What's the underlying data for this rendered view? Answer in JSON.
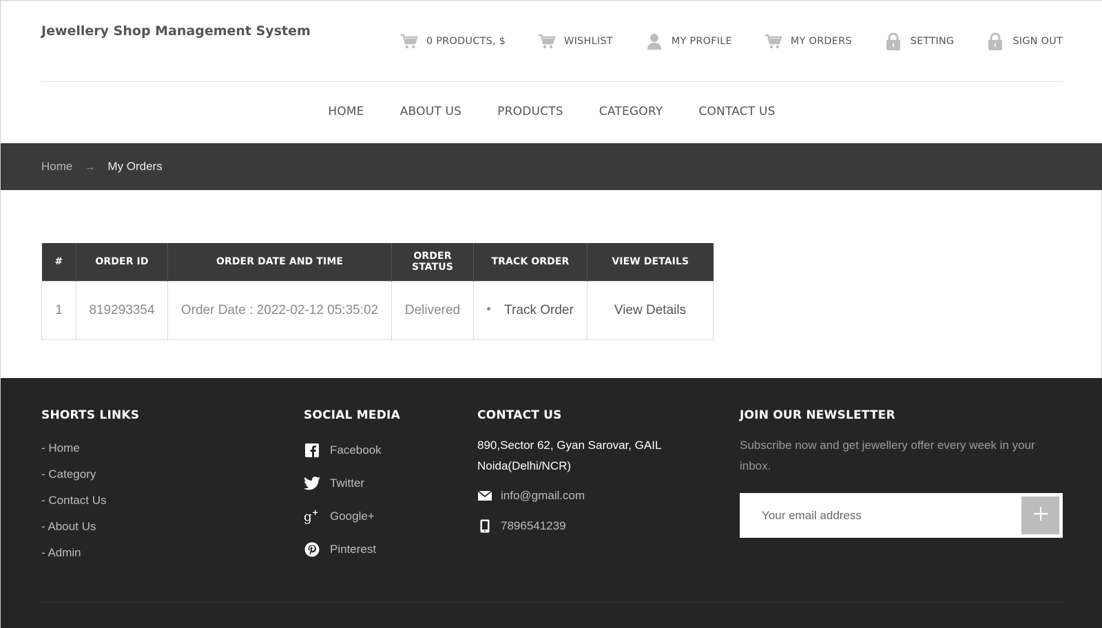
{
  "brand": "Jewellery Shop Management System",
  "topnav": [
    {
      "label": "0 PRODUCTS, $",
      "icon": "cart-icon"
    },
    {
      "label": "WISHLIST",
      "icon": "cart-icon"
    },
    {
      "label": "MY PROFILE",
      "icon": "user-icon"
    },
    {
      "label": "MY ORDERS",
      "icon": "cart-icon"
    },
    {
      "label": "SETTING",
      "icon": "lock-icon"
    },
    {
      "label": "SIGN OUT",
      "icon": "lock-icon"
    }
  ],
  "mainnav": [
    "HOME",
    "ABOUT US",
    "PRODUCTS",
    "CATEGORY",
    "CONTACT US"
  ],
  "breadcrumb": {
    "home": "Home",
    "separator": "→",
    "current": "My Orders"
  },
  "orders": {
    "headers": [
      "#",
      "ORDER ID",
      "ORDER DATE AND TIME",
      "ORDER STATUS",
      "TRACK ORDER",
      "VIEW DETAILS"
    ],
    "rows": [
      {
        "num": "1",
        "order_id": "819293354",
        "date": "Order Date : 2022-02-12 05:35:02",
        "status": "Delivered",
        "track": "Track Order",
        "view": "View Details"
      }
    ]
  },
  "footer": {
    "links_heading": "SHORTS LINKS",
    "links": [
      "- Home",
      "- Category",
      "- Contact Us",
      "- About Us",
      "- Admin"
    ],
    "social_heading": "SOCIAL MEDIA",
    "social": [
      {
        "label": "Facebook",
        "icon": "facebook-icon"
      },
      {
        "label": "Twitter",
        "icon": "twitter-icon"
      },
      {
        "label": "Google+",
        "icon": "google-plus-icon"
      },
      {
        "label": "Pinterest",
        "icon": "pinterest-icon"
      }
    ],
    "contact_heading": "CONTACT US",
    "address": "890,Sector 62, Gyan Sarovar, GAIL Noida(Delhi/NCR)",
    "email": "info@gmail.com",
    "phone": "7896541239",
    "newsletter_heading": "JOIN OUR NEWSLETTER",
    "newsletter_text": "Subscribe now and get jewellery offer every week in your inbox.",
    "newsletter_placeholder": "Your email address",
    "newsletter_button": "+"
  },
  "colors": {
    "dark_bar": "#3a3a3a",
    "footer_bg": "#252525",
    "icon_grey": "#bdbdbd"
  }
}
